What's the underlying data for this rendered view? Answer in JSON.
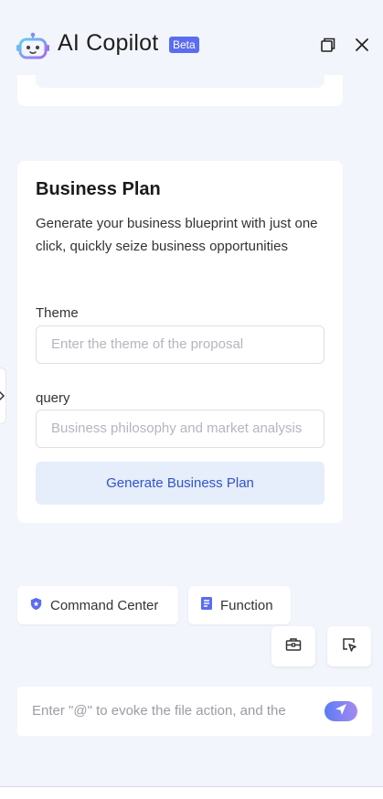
{
  "header": {
    "title": "AI Copilot",
    "badge": "Beta",
    "icons": {
      "logo": "robot-logo-icon",
      "popout": "popout-window-icon",
      "close": "close-icon"
    }
  },
  "card": {
    "title": "Business Plan",
    "description": "Generate your business blueprint with just one click, quickly seize business opportunities",
    "theme_label": "Theme",
    "theme_placeholder": "Enter the theme of the proposal",
    "query_label": "query",
    "query_placeholder": "Business philosophy and market analysis",
    "generate_label": "Generate Business Plan"
  },
  "quick_actions": [
    {
      "label": "Command Center",
      "icon": "shield-star-icon"
    },
    {
      "label": "Function",
      "icon": "document-icon"
    }
  ],
  "tools": {
    "toolbox": "toolbox-icon",
    "select": "pointer-select-icon"
  },
  "chat": {
    "placeholder": "Enter \"@\" to evoke the file action, and the",
    "send_icon": "send-icon"
  },
  "colors": {
    "background": "#f3f5fc",
    "accent": "#5b6cf0",
    "button_bg": "#e6edfb",
    "button_text": "#2f55c9"
  }
}
